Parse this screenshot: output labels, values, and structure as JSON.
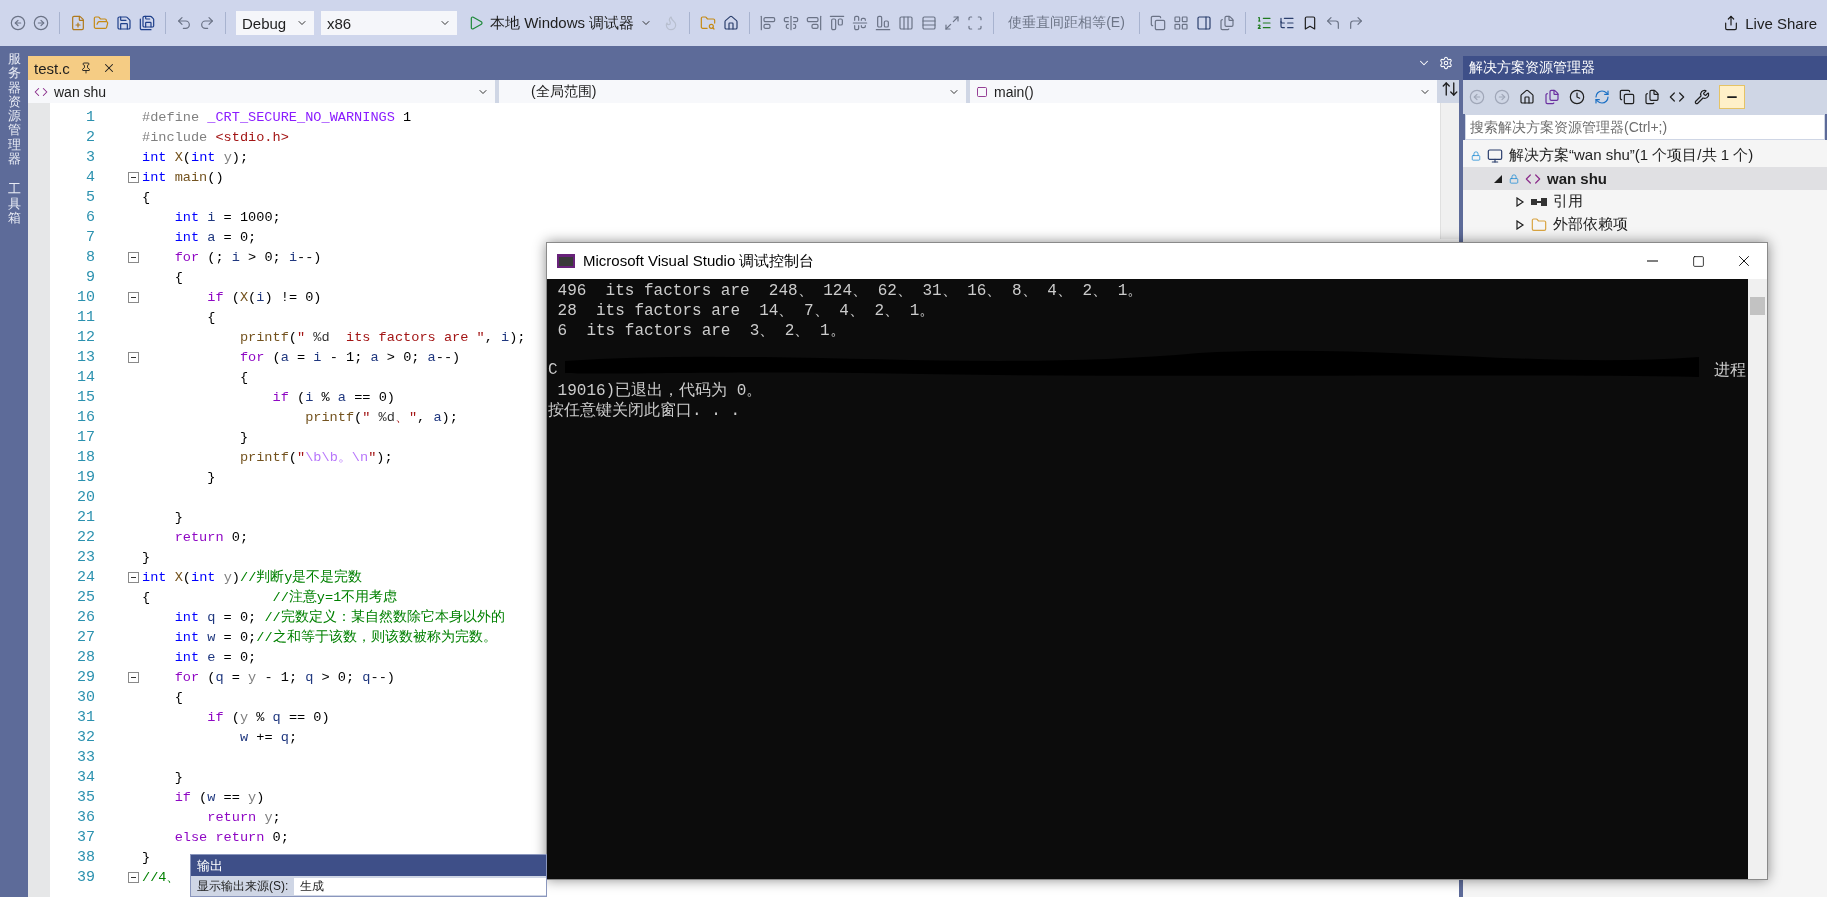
{
  "toolbar": {
    "configuration": "Debug",
    "platform": "x86",
    "run_target": "本地 Windows 调试器",
    "spacing_button": "使垂直间距相等(E)",
    "live_share": "Live Share"
  },
  "side_strip": [
    "服务器资源管理器",
    "工具箱"
  ],
  "editor": {
    "tabs": [
      {
        "label": "test.c",
        "selected": true
      }
    ],
    "nav": {
      "project": "wan shu",
      "scope": "(全局范围)",
      "member": "main()"
    },
    "lines": [
      {
        "number": "1",
        "tokens": [
          {
            "text": "#define",
            "kind": "preproc"
          },
          {
            "text": " _CRT_SECURE_NO_WARNINGS",
            "kind": "macro"
          },
          {
            "text": " 1",
            "kind": "plain"
          }
        ]
      },
      {
        "number": "2",
        "tokens": [
          {
            "text": "#include",
            "kind": "preproc"
          },
          {
            "text": " <stdio.h>",
            "kind": "string"
          }
        ]
      },
      {
        "number": "3",
        "tokens": [
          {
            "text": "int",
            "kind": "keyword"
          },
          {
            "text": " X",
            "kind": "func"
          },
          {
            "text": "(",
            "kind": "plain"
          },
          {
            "text": "int",
            "kind": "keyword"
          },
          {
            "text": " y",
            "kind": "param"
          },
          {
            "text": ");",
            "kind": "plain"
          }
        ]
      },
      {
        "number": "4",
        "fold": true,
        "tokens": [
          {
            "text": "int",
            "kind": "keyword"
          },
          {
            "text": " main",
            "kind": "func"
          },
          {
            "text": "()",
            "kind": "plain"
          }
        ]
      },
      {
        "number": "5",
        "tokens": [
          {
            "text": "{",
            "kind": "plain"
          }
        ]
      },
      {
        "number": "6",
        "tokens": [
          {
            "text": "    int",
            "kind": "keyword"
          },
          {
            "text": " i",
            "kind": "local"
          },
          {
            "text": " = 1000;",
            "kind": "plain"
          }
        ]
      },
      {
        "number": "7",
        "tokens": [
          {
            "text": "    int",
            "kind": "keyword"
          },
          {
            "text": " a",
            "kind": "local"
          },
          {
            "text": " = 0;",
            "kind": "plain"
          }
        ]
      },
      {
        "number": "8",
        "fold": true,
        "tokens": [
          {
            "text": "    for",
            "kind": "control"
          },
          {
            "text": " (; ",
            "kind": "plain"
          },
          {
            "text": "i",
            "kind": "local"
          },
          {
            "text": " > 0; ",
            "kind": "plain"
          },
          {
            "text": "i",
            "kind": "local"
          },
          {
            "text": "--)",
            "kind": "plain"
          }
        ]
      },
      {
        "number": "9",
        "tokens": [
          {
            "text": "    {",
            "kind": "plain"
          }
        ]
      },
      {
        "number": "10",
        "fold": true,
        "tokens": [
          {
            "text": "        if",
            "kind": "control"
          },
          {
            "text": " (",
            "kind": "plain"
          },
          {
            "text": "X",
            "kind": "func"
          },
          {
            "text": "(",
            "kind": "plain"
          },
          {
            "text": "i",
            "kind": "local"
          },
          {
            "text": ") != 0)",
            "kind": "plain"
          }
        ]
      },
      {
        "number": "11",
        "tokens": [
          {
            "text": "        {",
            "kind": "plain"
          }
        ]
      },
      {
        "number": "12",
        "tokens": [
          {
            "text": "            printf",
            "kind": "func"
          },
          {
            "text": "(",
            "kind": "plain"
          },
          {
            "text": "\" ",
            "kind": "string"
          },
          {
            "text": "%d",
            "kind": "format"
          },
          {
            "text": "  its factors are \"",
            "kind": "string"
          },
          {
            "text": ", ",
            "kind": "plain"
          },
          {
            "text": "i",
            "kind": "local"
          },
          {
            "text": ");",
            "kind": "plain"
          }
        ]
      },
      {
        "number": "13",
        "fold": true,
        "tokens": [
          {
            "text": "            for",
            "kind": "control"
          },
          {
            "text": " (",
            "kind": "plain"
          },
          {
            "text": "a",
            "kind": "local"
          },
          {
            "text": " = ",
            "kind": "plain"
          },
          {
            "text": "i",
            "kind": "local"
          },
          {
            "text": " - 1; ",
            "kind": "plain"
          },
          {
            "text": "a",
            "kind": "local"
          },
          {
            "text": " > 0; ",
            "kind": "plain"
          },
          {
            "text": "a",
            "kind": "local"
          },
          {
            "text": "--)",
            "kind": "plain"
          }
        ]
      },
      {
        "number": "14",
        "tokens": [
          {
            "text": "            {",
            "kind": "plain"
          }
        ]
      },
      {
        "number": "15",
        "tokens": [
          {
            "text": "                if",
            "kind": "control"
          },
          {
            "text": " (",
            "kind": "plain"
          },
          {
            "text": "i",
            "kind": "local"
          },
          {
            "text": " % ",
            "kind": "plain"
          },
          {
            "text": "a",
            "kind": "local"
          },
          {
            "text": " == 0)",
            "kind": "plain"
          }
        ]
      },
      {
        "number": "16",
        "tokens": [
          {
            "text": "                    printf",
            "kind": "func"
          },
          {
            "text": "(",
            "kind": "plain"
          },
          {
            "text": "\" ",
            "kind": "string"
          },
          {
            "text": "%d",
            "kind": "format"
          },
          {
            "text": "、\"",
            "kind": "string"
          },
          {
            "text": ", ",
            "kind": "plain"
          },
          {
            "text": "a",
            "kind": "local"
          },
          {
            "text": ");",
            "kind": "plain"
          }
        ]
      },
      {
        "number": "17",
        "tokens": [
          {
            "text": "            }",
            "kind": "plain"
          }
        ]
      },
      {
        "number": "18",
        "tokens": [
          {
            "text": "            printf",
            "kind": "func"
          },
          {
            "text": "(",
            "kind": "plain"
          },
          {
            "text": "\"",
            "kind": "string"
          },
          {
            "text": "\\b\\b。\\n",
            "kind": "escape"
          },
          {
            "text": "\"",
            "kind": "string"
          },
          {
            "text": ");",
            "kind": "plain"
          }
        ]
      },
      {
        "number": "19",
        "tokens": [
          {
            "text": "        }",
            "kind": "plain"
          }
        ]
      },
      {
        "number": "20"
      },
      {
        "number": "21",
        "tokens": [
          {
            "text": "    }",
            "kind": "plain"
          }
        ]
      },
      {
        "number": "22",
        "tokens": [
          {
            "text": "    return",
            "kind": "control"
          },
          {
            "text": " 0;",
            "kind": "plain"
          }
        ]
      },
      {
        "number": "23",
        "tokens": [
          {
            "text": "}",
            "kind": "plain"
          }
        ]
      },
      {
        "number": "24",
        "fold": true,
        "tokens": [
          {
            "text": "int",
            "kind": "keyword"
          },
          {
            "text": " X",
            "kind": "func"
          },
          {
            "text": "(",
            "kind": "plain"
          },
          {
            "text": "int",
            "kind": "keyword"
          },
          {
            "text": " y",
            "kind": "param"
          },
          {
            "text": ")",
            "kind": "plain"
          },
          {
            "text": "//判断y是不是完数",
            "kind": "comment"
          }
        ]
      },
      {
        "number": "25",
        "tokens": [
          {
            "text": "{",
            "kind": "plain"
          },
          {
            "text": "               //注意y=1不用考虑",
            "kind": "comment"
          }
        ]
      },
      {
        "number": "26",
        "tokens": [
          {
            "text": "    int",
            "kind": "keyword"
          },
          {
            "text": " q",
            "kind": "local"
          },
          {
            "text": " = 0;",
            "kind": "plain"
          },
          {
            "text": " //完数定义：某自然数除它本身以外的",
            "kind": "comment"
          }
        ]
      },
      {
        "number": "27",
        "tokens": [
          {
            "text": "    int",
            "kind": "keyword"
          },
          {
            "text": " w",
            "kind": "local"
          },
          {
            "text": " = 0;",
            "kind": "plain"
          },
          {
            "text": "//之和等于该数，则该数被称为完数。",
            "kind": "comment"
          }
        ]
      },
      {
        "number": "28",
        "tokens": [
          {
            "text": "    int",
            "kind": "keyword"
          },
          {
            "text": " e",
            "kind": "local"
          },
          {
            "text": " = 0;",
            "kind": "plain"
          }
        ]
      },
      {
        "number": "29",
        "fold": true,
        "tokens": [
          {
            "text": "    for",
            "kind": "control"
          },
          {
            "text": " (",
            "kind": "plain"
          },
          {
            "text": "q",
            "kind": "local"
          },
          {
            "text": " = ",
            "kind": "plain"
          },
          {
            "text": "y",
            "kind": "param"
          },
          {
            "text": " - 1; ",
            "kind": "plain"
          },
          {
            "text": "q",
            "kind": "local"
          },
          {
            "text": " > 0; ",
            "kind": "plain"
          },
          {
            "text": "q",
            "kind": "local"
          },
          {
            "text": "--)",
            "kind": "plain"
          }
        ]
      },
      {
        "number": "30",
        "tokens": [
          {
            "text": "    {",
            "kind": "plain"
          }
        ]
      },
      {
        "number": "31",
        "tokens": [
          {
            "text": "        if",
            "kind": "control"
          },
          {
            "text": " (",
            "kind": "plain"
          },
          {
            "text": "y",
            "kind": "param"
          },
          {
            "text": " % ",
            "kind": "plain"
          },
          {
            "text": "q",
            "kind": "local"
          },
          {
            "text": " == 0)",
            "kind": "plain"
          }
        ]
      },
      {
        "number": "32",
        "tokens": [
          {
            "text": "            w",
            "kind": "local"
          },
          {
            "text": " += ",
            "kind": "plain"
          },
          {
            "text": "q",
            "kind": "local"
          },
          {
            "text": ";",
            "kind": "plain"
          }
        ]
      },
      {
        "number": "33"
      },
      {
        "number": "34",
        "tokens": [
          {
            "text": "    }",
            "kind": "plain"
          }
        ]
      },
      {
        "number": "35",
        "tokens": [
          {
            "text": "    if",
            "kind": "control"
          },
          {
            "text": " (",
            "kind": "plain"
          },
          {
            "text": "w",
            "kind": "local"
          },
          {
            "text": " == ",
            "kind": "plain"
          },
          {
            "text": "y",
            "kind": "param"
          },
          {
            "text": ")",
            "kind": "plain"
          }
        ]
      },
      {
        "number": "36",
        "tokens": [
          {
            "text": "        return",
            "kind": "control"
          },
          {
            "text": " y",
            "kind": "param"
          },
          {
            "text": ";",
            "kind": "plain"
          }
        ]
      },
      {
        "number": "37",
        "tokens": [
          {
            "text": "    else",
            "kind": "control"
          },
          {
            "text": " return",
            "kind": "control"
          },
          {
            "text": " 0;",
            "kind": "plain"
          }
        ]
      },
      {
        "number": "38",
        "tokens": [
          {
            "text": "}",
            "kind": "plain"
          }
        ]
      },
      {
        "number": "39",
        "fold": true,
        "tokens": [
          {
            "text": "//4、",
            "kind": "comment"
          }
        ]
      }
    ]
  },
  "console": {
    "title": "Microsoft Visual Studio 调试控制台",
    "lines": [
      {
        "kind": "text",
        "text": " 496  its factors are  248、 124、 62、 31、 16、 8、 4、 2、 1。"
      },
      {
        "kind": "text",
        "text": " 28  its factors are  14、 7、 4、 2、 1。"
      },
      {
        "kind": "text",
        "text": " 6  its factors are  3、 2、 1。"
      },
      {
        "kind": "blank"
      },
      {
        "kind": "text",
        "text": "C",
        "trailing": "进程"
      },
      {
        "kind": "text",
        "text": " 19016)已退出，代码为 0。"
      },
      {
        "kind": "text",
        "text": "按任意键关闭此窗口. . ."
      }
    ]
  },
  "solution_explorer": {
    "title": "解决方案资源管理器",
    "search": {
      "placeholder": "搜索解决方案资源管理器(Ctrl+;)"
    },
    "tree": [
      {
        "label": "解决方案“wan shu”(1 个项目/共 1 个)",
        "kind": "solution",
        "selected": false,
        "children": [
          {
            "label": "wan shu",
            "kind": "project",
            "expanded": true,
            "selected": true,
            "children": [
              {
                "label": "引用",
                "kind": "references",
                "expanded": false,
                "selected": false
              },
              {
                "label": "外部依赖项",
                "kind": "dependencies",
                "expanded": false,
                "selected": false
              }
            ]
          }
        ]
      }
    ]
  },
  "output": {
    "title": "输出",
    "source_label": "显示输出来源(S):",
    "source": "生成"
  }
}
